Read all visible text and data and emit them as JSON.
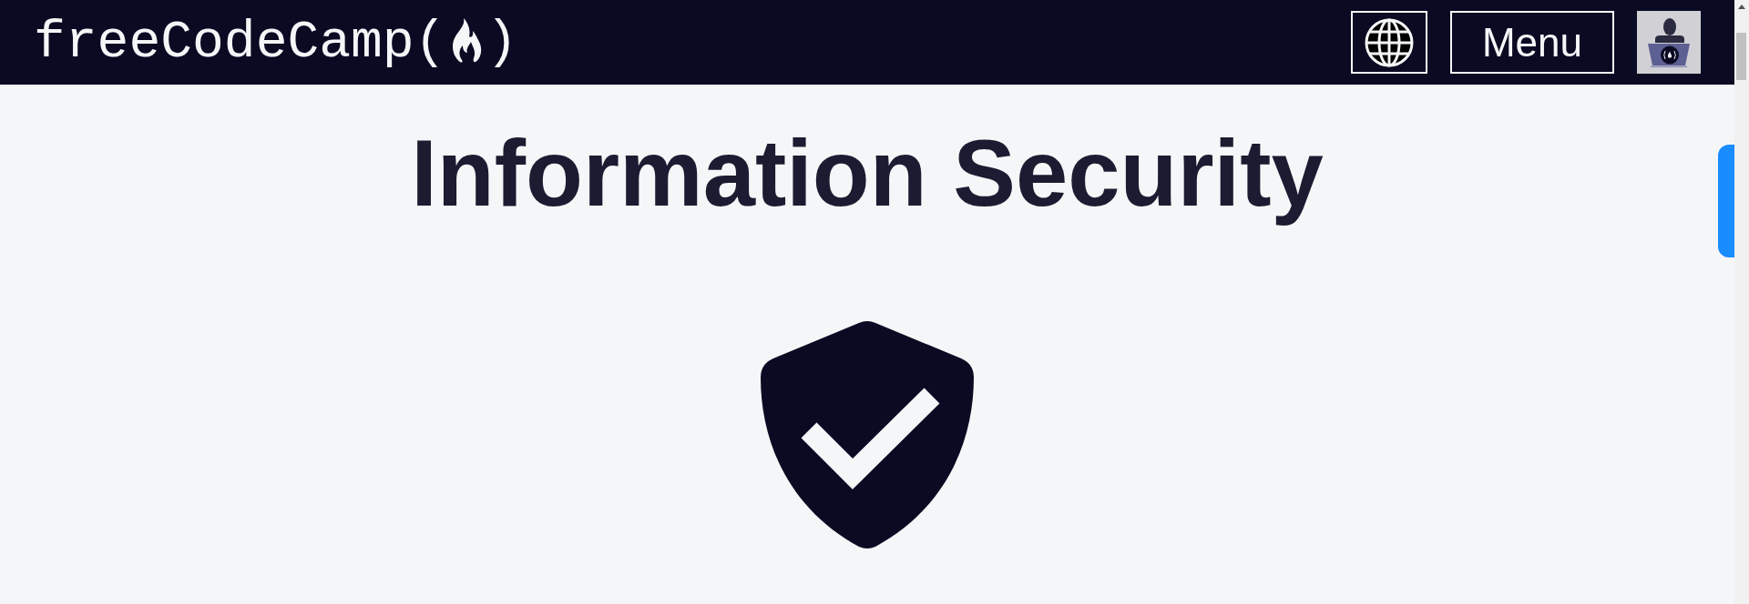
{
  "header": {
    "logo": {
      "text_before": "freeCodeCamp(",
      "text_after": ")"
    },
    "menu_button": {
      "label": "Menu"
    }
  },
  "page": {
    "title": "Information Security"
  }
}
